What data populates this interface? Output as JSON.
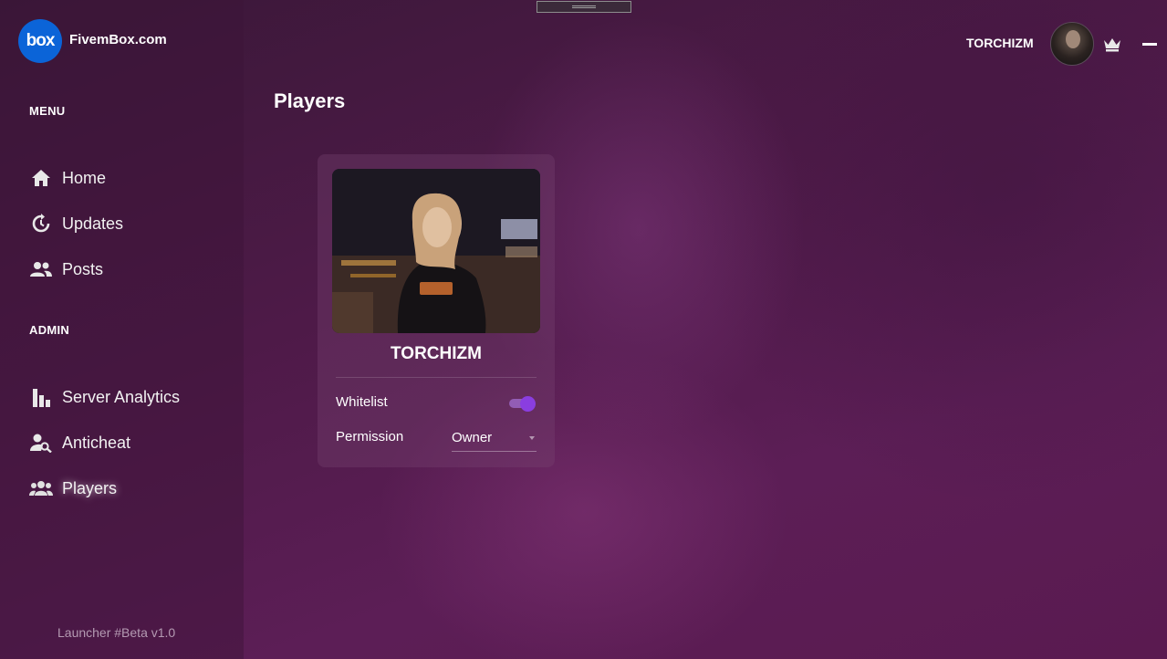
{
  "window": {
    "handle": "drag-handle"
  },
  "brand": {
    "logo_text": "box",
    "name": "FivemBox.com",
    "logo_color": "#0b64d8"
  },
  "sidebar": {
    "menu_label": "MENU",
    "admin_label": "ADMIN",
    "menu_items": [
      {
        "label": "Home",
        "icon": "home-icon"
      },
      {
        "label": "Updates",
        "icon": "updates-icon"
      },
      {
        "label": "Posts",
        "icon": "users-icon"
      }
    ],
    "admin_items": [
      {
        "label": "Server Analytics",
        "icon": "bar-chart-icon"
      },
      {
        "label": "Anticheat",
        "icon": "user-search-icon"
      },
      {
        "label": "Players",
        "icon": "users-icon",
        "active": true
      }
    ],
    "version": "Launcher #Beta v1.0"
  },
  "header": {
    "user_name": "TORCHIZM",
    "badge_icon": "crown-icon"
  },
  "main": {
    "title": "Players",
    "player": {
      "name": "TORCHIZM",
      "whitelist_label": "Whitelist",
      "whitelist_on": true,
      "permission_label": "Permission",
      "permission_value": "Owner"
    }
  },
  "colors": {
    "accent": "#8a3ee0",
    "background": "#4e1a48"
  }
}
